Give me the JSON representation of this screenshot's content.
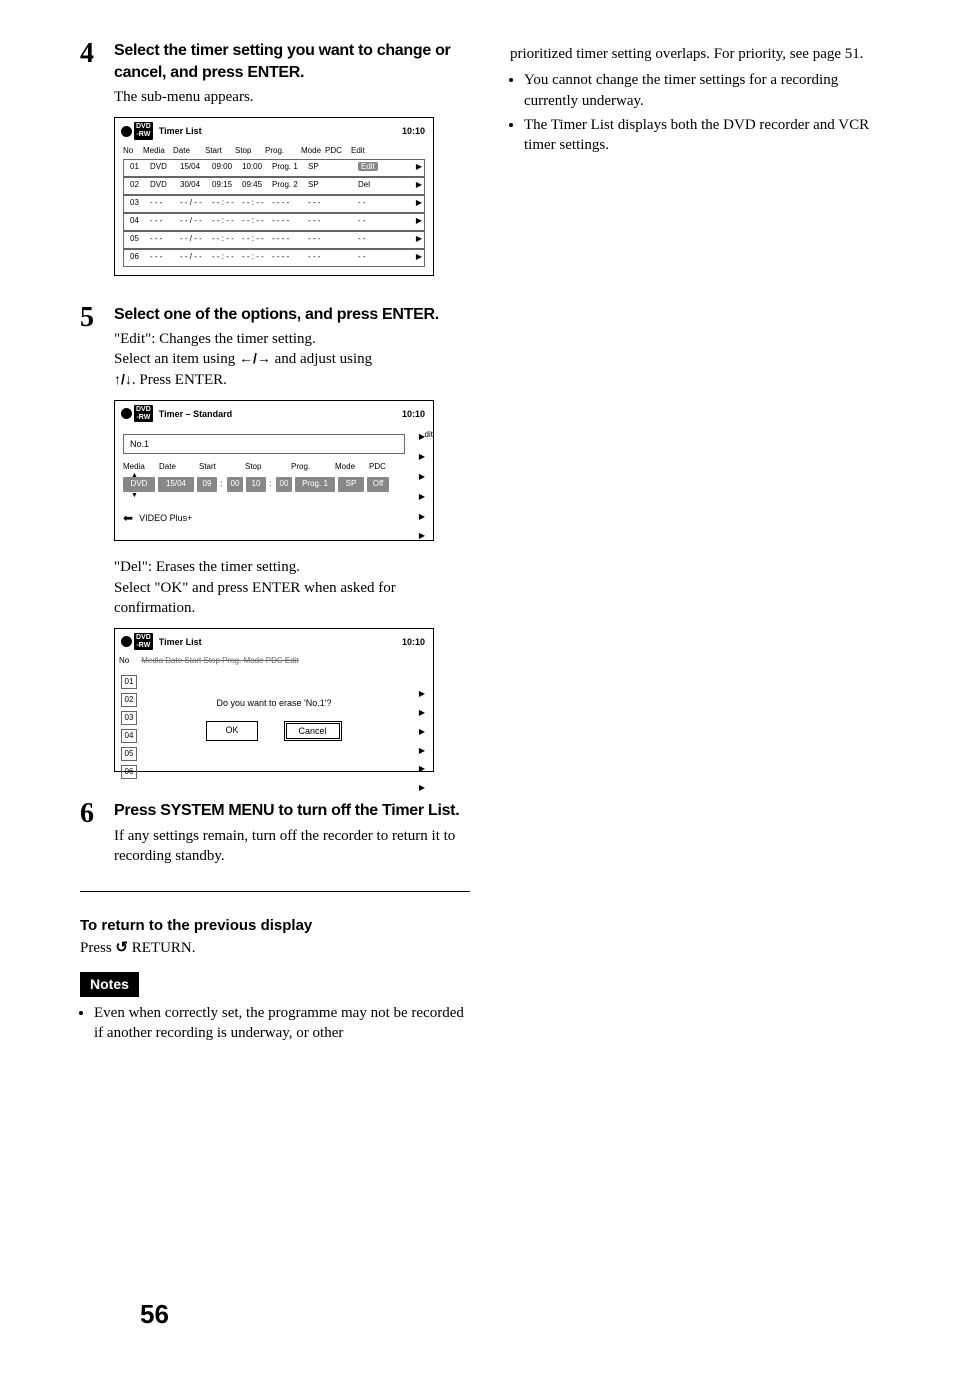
{
  "left": {
    "step4": {
      "num": "4",
      "title": "Select the timer setting you want to change or cancel, and press ENTER.",
      "desc": "The sub-menu appears."
    },
    "panel1": {
      "title": "Timer List",
      "time": "10:10",
      "rw1": "DVD",
      "rw2": "-RW",
      "head": {
        "no": "No",
        "media": "Media",
        "date": "Date",
        "start": "Start",
        "stop": "Stop",
        "prog": "Prog.",
        "mode": "Mode",
        "pdc": "PDC",
        "edit": "Edit"
      },
      "rows": [
        {
          "no": "01",
          "media": "DVD",
          "date": "15/04",
          "start": "09:00",
          "stop": "10:00",
          "prog": "Prog. 1",
          "mode": "SP",
          "pdc": "Edit",
          "pill": true
        },
        {
          "no": "02",
          "media": "DVD",
          "date": "30/04",
          "start": "09:15",
          "stop": "09:45",
          "prog": "Prog. 2",
          "mode": "SP",
          "pdc": "Del",
          "pill": false
        },
        {
          "no": "03",
          "media": "- - -",
          "date": "- - / - -",
          "start": "- - : - -",
          "stop": "- - : - -",
          "prog": "- - - -",
          "mode": "- - -",
          "pdc": "- -",
          "pill": false
        },
        {
          "no": "04",
          "media": "- - -",
          "date": "- - / - -",
          "start": "- - : - -",
          "stop": "- - : - -",
          "prog": "- - - -",
          "mode": "- - -",
          "pdc": "- -",
          "pill": false
        },
        {
          "no": "05",
          "media": "- - -",
          "date": "- - / - -",
          "start": "- - : - -",
          "stop": "- - : - -",
          "prog": "- - - -",
          "mode": "- - -",
          "pdc": "- -",
          "pill": false
        },
        {
          "no": "06",
          "media": "- - -",
          "date": "- - / - -",
          "start": "- - : - -",
          "stop": "- - : - -",
          "prog": "- - - -",
          "mode": "- - -",
          "pdc": "- -",
          "pill": false
        }
      ]
    },
    "step5": {
      "num": "5",
      "title": "Select one of the options, and press ENTER.",
      "line1": "\"Edit\": Changes the timer setting.",
      "line2a": "Select an item using ",
      "line2_arrows": "←/→",
      "line2b": " and adjust using ",
      "line3_arrows": "↑/↓",
      "line3b": ". Press ENTER."
    },
    "panel2": {
      "title": "Timer – Standard",
      "time": "10:10",
      "no": "No.1",
      "side_label": "dit",
      "head": {
        "media": "Media",
        "date": "Date",
        "start": "Start",
        "stop": "Stop",
        "prog": "Prog.",
        "mode": "Mode",
        "pdc": "PDC"
      },
      "row": {
        "media": "DVD",
        "date": "15/04",
        "h1": "09",
        "m1": "00",
        "h2": "10",
        "m2": "00",
        "prog": "Prog. 1",
        "mode": "SP",
        "pdc": "Off"
      },
      "vp_text": "VIDEO Plus+"
    },
    "del1": "\"Del\": Erases the timer setting.",
    "del2": "Select \"OK\" and press ENTER when asked for confirmation.",
    "panel3": {
      "title": "Timer List",
      "time": "10:10",
      "head_no": "No",
      "head_rest": "Media     Date     Start     Stop     Prog.          Mode   PDC   Edit",
      "side_nos": [
        "01",
        "02",
        "03",
        "04",
        "05",
        "06"
      ],
      "msg": "Do you want to erase 'No.1'?",
      "ok": "OK",
      "cancel": "Cancel"
    },
    "step6": {
      "num": "6",
      "title": "Press SYSTEM MENU to turn off the Timer List.",
      "desc": "If any settings remain, turn off the recorder to return it to recording standby."
    },
    "return_title": "To return to the previous display",
    "return_text": "Press     RETURN.",
    "notes_label": "Notes",
    "note1": "Even when correctly set, the programme may not be recorded if another recording is underway, or other"
  },
  "right": {
    "cont": "prioritized timer setting overlaps. For priority, see page 51.",
    "bullets": [
      "You cannot change the timer settings for a recording currently underway.",
      "The Timer List displays both the DVD recorder and VCR timer settings."
    ]
  },
  "page": "56"
}
